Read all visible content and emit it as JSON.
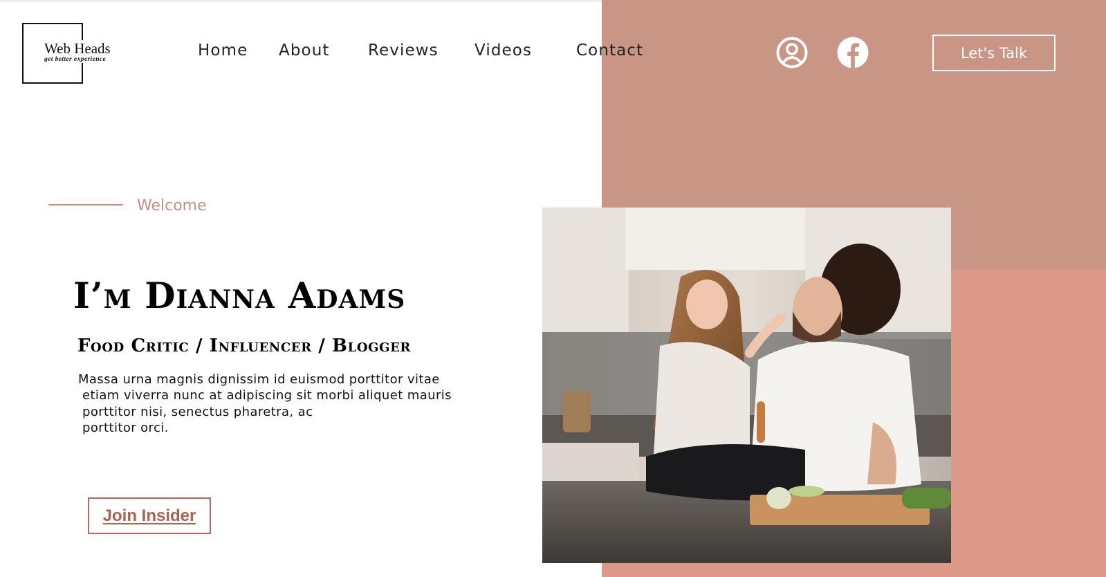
{
  "logo": {
    "title": "Web Heads",
    "tagline": "get better experience"
  },
  "nav": {
    "items": [
      {
        "label": "Home"
      },
      {
        "label": "About"
      },
      {
        "label": "Reviews"
      },
      {
        "label": "Videos"
      },
      {
        "label": "Contact"
      }
    ]
  },
  "header": {
    "icons": [
      {
        "name": "user-account-icon"
      },
      {
        "name": "facebook-icon"
      }
    ],
    "cta_label": "Let's Talk"
  },
  "hero": {
    "kicker": "Welcome",
    "title": "I’m Dianna Adams",
    "subtitle": "Food Critic / Influencer / Blogger",
    "body_lines": [
      "Massa urna magnis dignissim id euismod porttitor vitae",
      "etiam viverra nunc at adipiscing sit morbi aliquet mauris",
      "porttitor nisi, senectus pharetra, ac",
      "porttitor orci."
    ],
    "button_label": "Join Insider"
  },
  "colors": {
    "panel_dark": "#c99585",
    "panel_light": "#de9a89",
    "accent_text": "#c98f80",
    "button_text": "#a8634f"
  }
}
